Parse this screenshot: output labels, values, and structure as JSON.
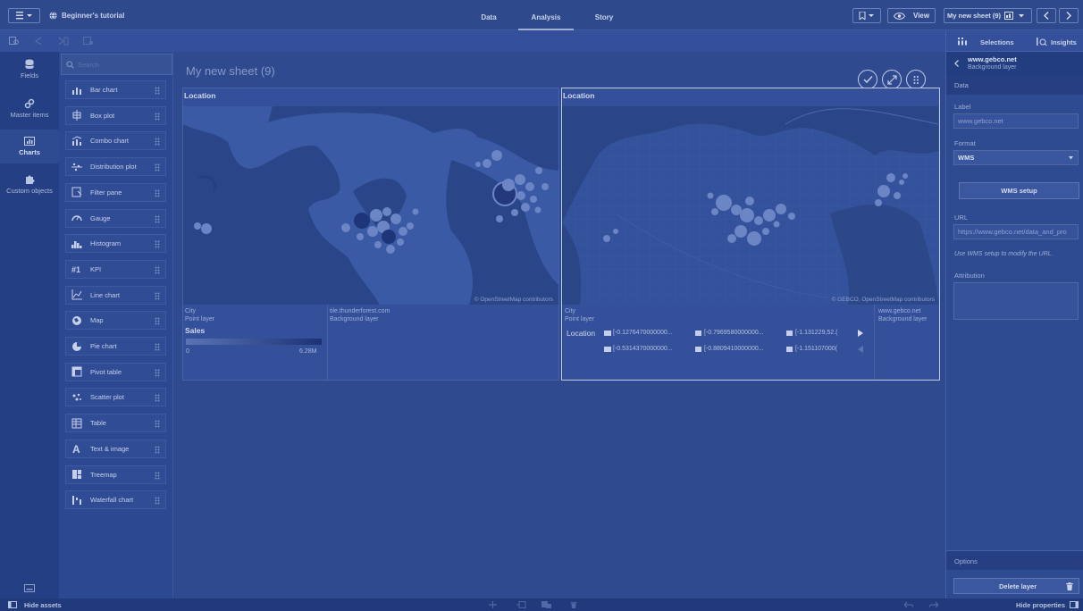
{
  "topbar": {
    "app_title": "Beginner's tutorial",
    "tabs": [
      {
        "label": "Data",
        "active": false
      },
      {
        "label": "Analysis",
        "active": true
      },
      {
        "label": "Story",
        "active": false
      }
    ],
    "view_label": "View",
    "sheet_selector": "My new sheet (9)"
  },
  "leftnav": {
    "items": [
      {
        "label": "Fields",
        "icon": "database-icon"
      },
      {
        "label": "Master items",
        "icon": "link-icon"
      },
      {
        "label": "Charts",
        "icon": "chart-icon",
        "active": true
      },
      {
        "label": "Custom objects",
        "icon": "puzzle-icon"
      }
    ]
  },
  "assets": {
    "search_placeholder": "Search",
    "items": [
      {
        "label": "Bar chart",
        "icon": "bar-chart-icon"
      },
      {
        "label": "Box plot",
        "icon": "box-plot-icon"
      },
      {
        "label": "Combo chart",
        "icon": "combo-chart-icon"
      },
      {
        "label": "Distribution plot",
        "icon": "distribution-plot-icon"
      },
      {
        "label": "Filter pane",
        "icon": "filter-pane-icon"
      },
      {
        "label": "Gauge",
        "icon": "gauge-icon"
      },
      {
        "label": "Histogram",
        "icon": "histogram-icon"
      },
      {
        "label": "KPI",
        "icon": "kpi-icon"
      },
      {
        "label": "Line chart",
        "icon": "line-chart-icon"
      },
      {
        "label": "Map",
        "icon": "map-icon"
      },
      {
        "label": "Pie chart",
        "icon": "pie-chart-icon"
      },
      {
        "label": "Pivot table",
        "icon": "pivot-table-icon"
      },
      {
        "label": "Scatter plot",
        "icon": "scatter-plot-icon"
      },
      {
        "label": "Table",
        "icon": "table-icon"
      },
      {
        "label": "Text & image",
        "icon": "text-image-icon"
      },
      {
        "label": "Treemap",
        "icon": "treemap-icon"
      },
      {
        "label": "Waterfall chart",
        "icon": "waterfall-chart-icon"
      }
    ]
  },
  "sheet": {
    "title": "My new sheet (9)",
    "map1": {
      "title": "Location",
      "attribution": "© OpenStreetMap contributors",
      "layers": [
        {
          "name": "City",
          "type": "Point layer"
        },
        {
          "name": "tile.thunderforest.com",
          "type": "Background layer"
        }
      ],
      "legend_title": "Sales",
      "legend_min": "0",
      "legend_max": "6.28M"
    },
    "map2": {
      "title": "Location",
      "attribution": "© GEBCO, OpenStreetMap contributors",
      "layers": [
        {
          "name": "City",
          "type": "Point layer"
        },
        {
          "name": "www.gebco.net",
          "type": "Background layer"
        }
      ],
      "legend_label": "Location",
      "legend_items": [
        "[-0.1276470000000...",
        "[-0.7969580000000...",
        "[-1.131229,52.(",
        "[-0.5314370000000...",
        "[-0.8809410000000...",
        "[-1.151107000("
      ]
    }
  },
  "rightpanel": {
    "selections_label": "Selections",
    "insights_label": "Insights",
    "header_title": "www.gebco.net",
    "header_subtitle": "Background layer",
    "section_data": "Data",
    "label_label": "Label",
    "label_value": "www.gebco.net",
    "format_label": "Format",
    "format_value": "WMS",
    "wms_setup_button": "WMS setup",
    "url_label": "URL",
    "url_value": "https://www.gebco.net/data_and_pro",
    "url_hint": "Use WMS setup to modify the URL.",
    "attribution_label": "Attribution",
    "section_options": "Options",
    "delete_button": "Delete layer"
  },
  "bottombar": {
    "hide_assets": "Hide assets",
    "hide_properties": "Hide properties"
  },
  "colors": {
    "overlay": "#2f4a8f",
    "ocean": "#3a5aa6",
    "land": "#2a4688",
    "bubble": "#6c85c4",
    "bubble_dark": "#1f357a"
  }
}
